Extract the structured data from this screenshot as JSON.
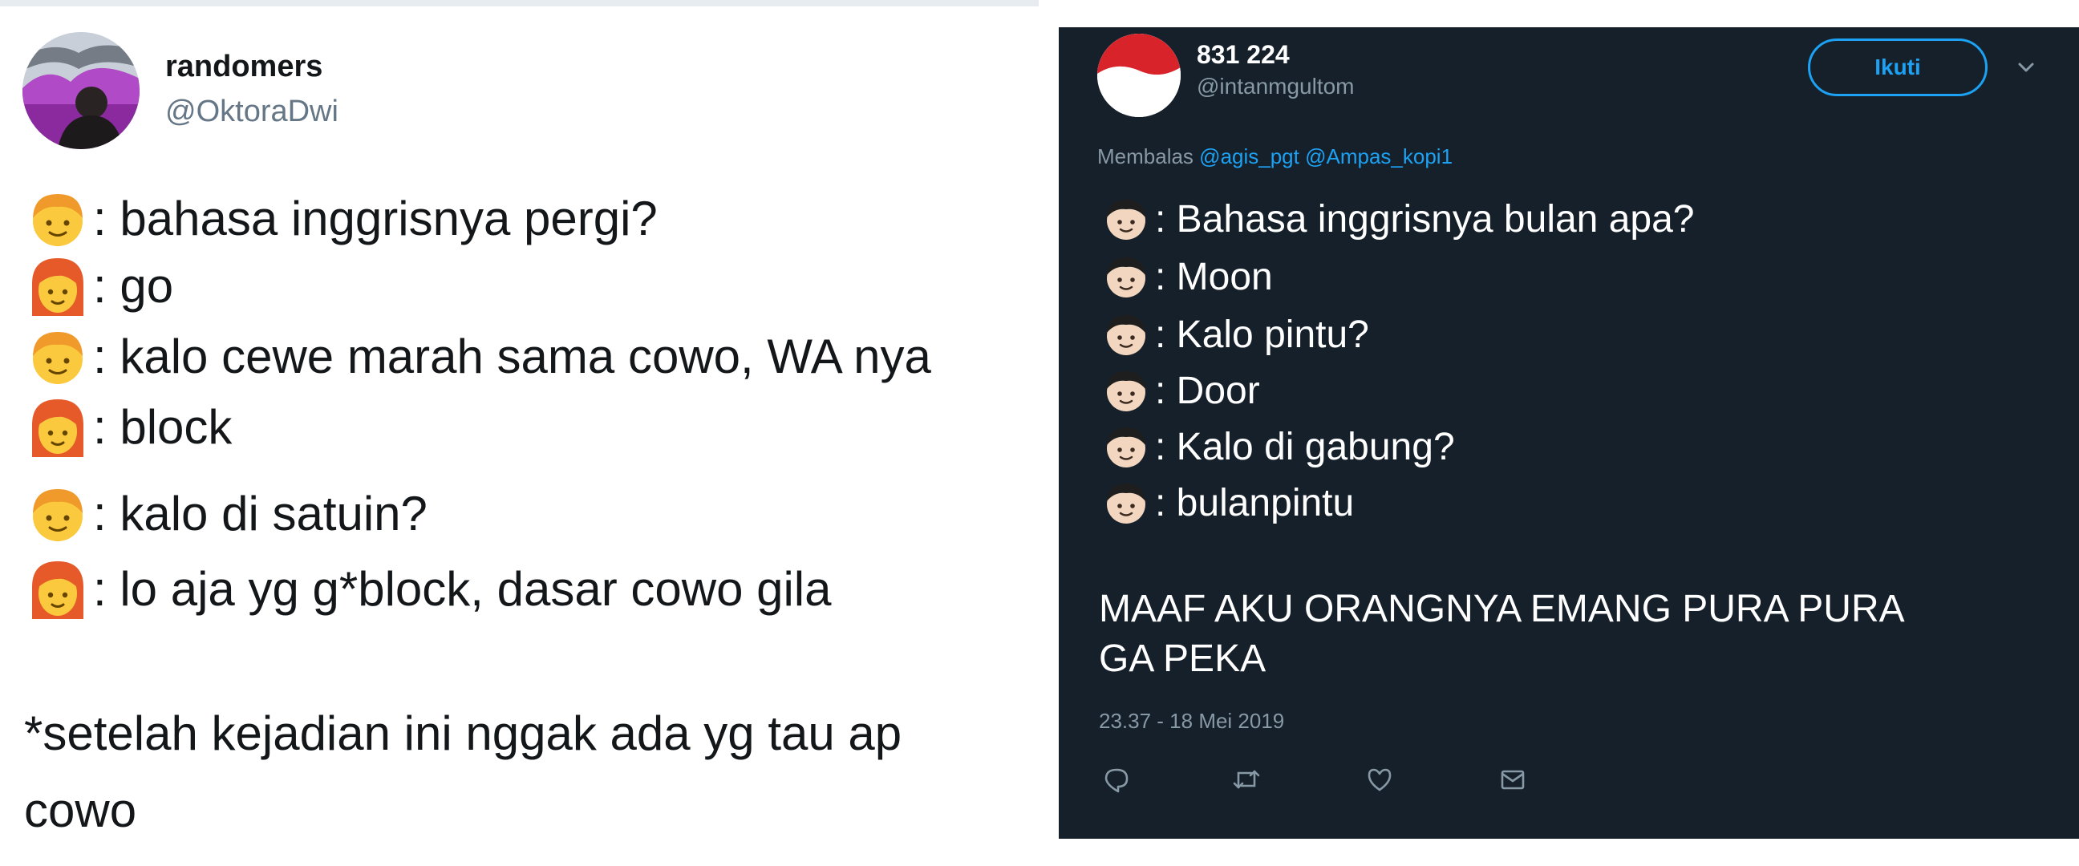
{
  "left_tweet": {
    "display_name": "randomers",
    "handle": "@OktoraDwi",
    "lines": [
      {
        "speaker": "boy",
        "text": ": bahasa inggrisnya pergi?"
      },
      {
        "speaker": "girl",
        "text": " : go"
      },
      {
        "speaker": "boy",
        "text": ": kalo cewe marah sama cowo, WA nya"
      },
      {
        "speaker": "girl",
        "text": " : block"
      },
      {
        "speaker": "boy",
        "text": ": kalo di satuin?"
      },
      {
        "speaker": "girl",
        "text": " : lo aja yg g*block, dasar cowo gila"
      }
    ],
    "note_line1": "*setelah kejadian ini nggak ada yg tau ap",
    "note_line2": "cowo"
  },
  "right_tweet": {
    "display_name": "831 224",
    "handle": "@intanmgultom",
    "follow_label": "Ikuti",
    "replying_prefix": "Membalas",
    "mentions": [
      "@agis_pgt",
      "@Ampas_kopi1"
    ],
    "lines": [
      " : Bahasa inggrisnya bulan apa?",
      ": Moon",
      " : Kalo pintu?",
      ": Door",
      ": Kalo di gabung?",
      " : bulanpintu"
    ],
    "caps_line1": "MAAF AKU ORANGNYA EMANG PURA PURA",
    "caps_line2": "GA PEKA",
    "timestamp": "23.37 - 18 Mei 2019",
    "actions": [
      "reply-icon",
      "retweet-icon",
      "like-icon",
      "message-icon"
    ]
  },
  "colors": {
    "dark_bg": "#15202b",
    "accent": "#1da1f2",
    "muted_dark": "#8899a6",
    "muted_light": "#657786"
  }
}
